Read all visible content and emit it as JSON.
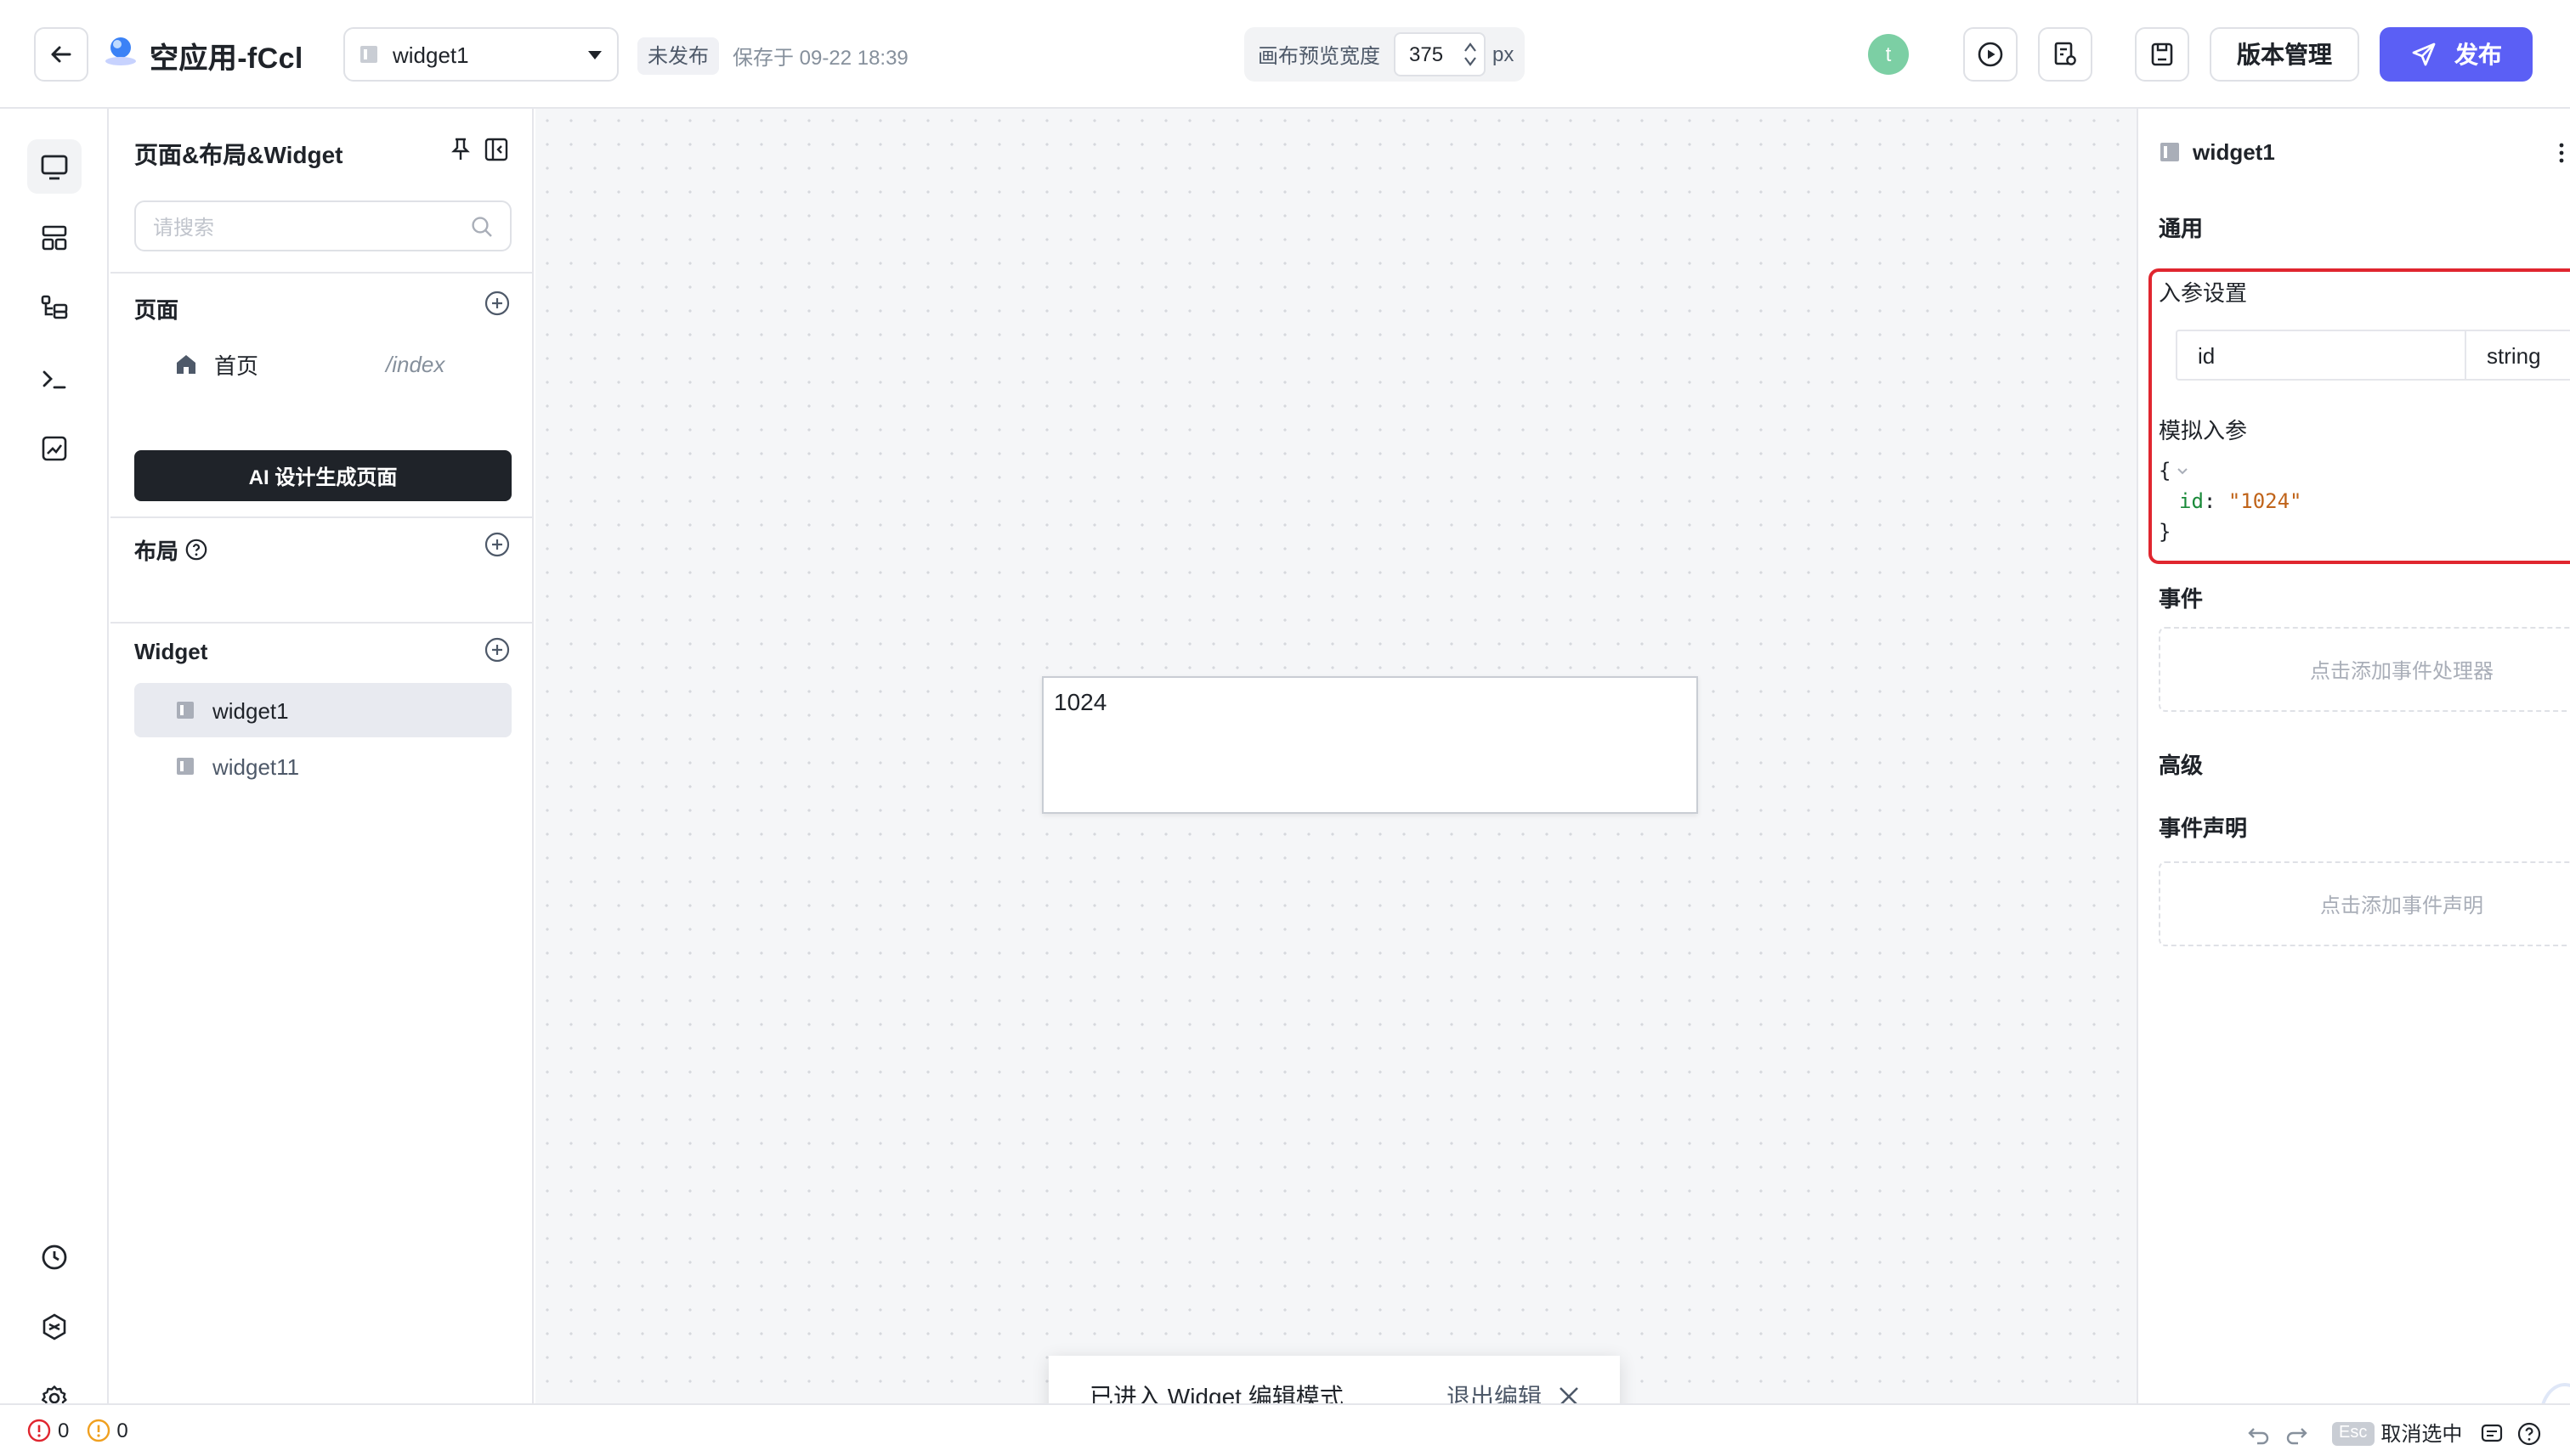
{
  "header": {
    "app_title": "空应用-fCcl",
    "widget_select": "widget1",
    "status": "未发布",
    "saved_at": "保存于 09-22 18:39",
    "canvas_width_label": "画布预览宽度",
    "canvas_width_value": "375",
    "canvas_width_unit": "px",
    "avatar_initial": "t",
    "version_label": "版本管理",
    "publish_label": "发布"
  },
  "rail": {
    "icons": [
      "monitor-icon",
      "layout-icon",
      "tree-icon",
      "terminal-icon",
      "chart-icon",
      "clock-icon",
      "plugin-icon",
      "settings-icon"
    ]
  },
  "left_panel": {
    "title": "页面&布局&Widget",
    "search_placeholder": "请搜索",
    "pages_title": "页面",
    "pages": [
      {
        "name": "首页",
        "path": "/index"
      }
    ],
    "ai_button": "AI 设计生成页面",
    "layout_title": "布局",
    "widget_title": "Widget",
    "widgets": [
      {
        "name": "widget1",
        "selected": true
      },
      {
        "name": "widget11",
        "selected": false
      }
    ]
  },
  "canvas": {
    "preview_text": "1024",
    "toast_text": "已进入 Widget 编辑模式",
    "toast_exit": "退出编辑"
  },
  "right_panel": {
    "title": "widget1",
    "general": "通用",
    "params_title": "入参设置",
    "param_name": "id",
    "param_type": "string",
    "mock_title": "模拟入参",
    "mock_open": "{",
    "mock_key": "id",
    "mock_value": "\"1024\"",
    "mock_close": "}",
    "events_title": "事件",
    "events_add": "点击添加事件处理器",
    "advanced": "高级",
    "decl_title": "事件声明",
    "decl_add": "点击添加事件声明"
  },
  "bottom": {
    "errors": "0",
    "warnings": "0",
    "esc_key": "Esc",
    "deselect": "取消选中"
  },
  "colors": {
    "accent": "#5b5ff5",
    "highlight": "#e0262f",
    "avatar": "#7ccfa4"
  }
}
